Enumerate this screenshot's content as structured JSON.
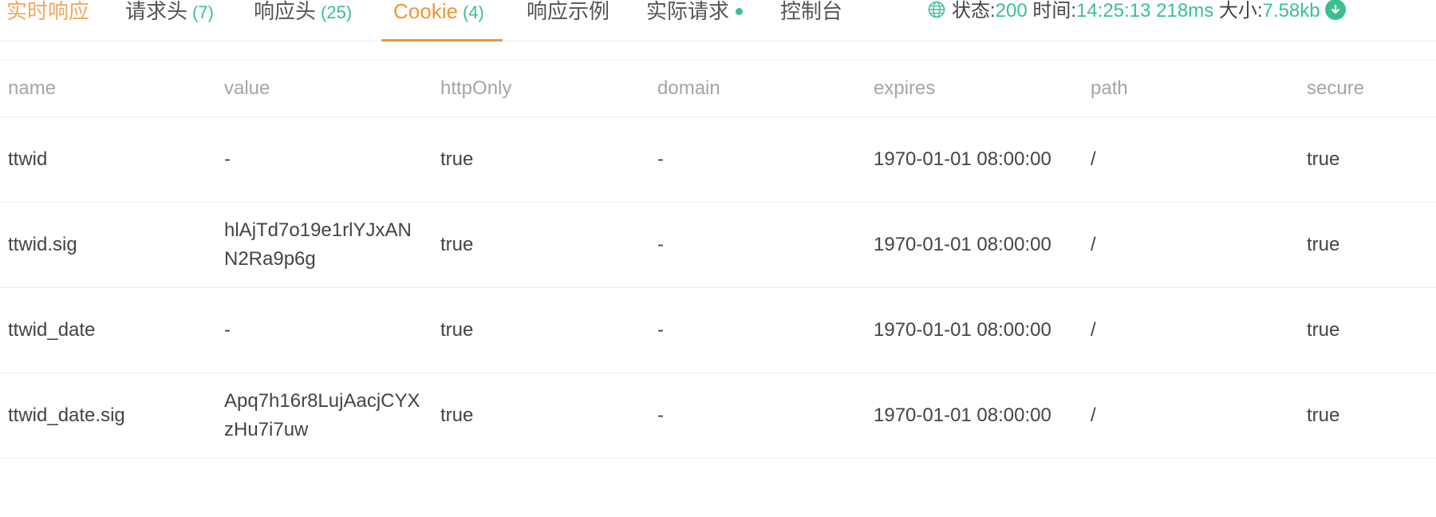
{
  "tabs": [
    {
      "label": "实时响应",
      "count": ""
    },
    {
      "label": "请求头",
      "count": "(7)"
    },
    {
      "label": "响应头",
      "count": "(25)"
    },
    {
      "label": "Cookie",
      "count": "(4)"
    },
    {
      "label": "响应示例",
      "count": ""
    },
    {
      "label": "实际请求",
      "count": ""
    },
    {
      "label": "控制台",
      "count": ""
    }
  ],
  "active_tab": "Cookie",
  "status_bar": {
    "status_label": "状态:",
    "status_value": "200",
    "time_label": "时间:",
    "time_value": "14:25:13",
    "duration_value": "218ms",
    "size_label": "大小:",
    "size_value": "7.58kb"
  },
  "colors": {
    "accent": "#f0953a",
    "success": "#3cbf8f",
    "header_text": "#a5a5a5"
  },
  "icons": {
    "status": "globe-icon",
    "download": "download-icon",
    "realtime_indicator": "green-dot"
  },
  "table": {
    "columns": [
      "name",
      "value",
      "httpOnly",
      "domain",
      "expires",
      "path",
      "secure"
    ],
    "rows": [
      {
        "name": "ttwid",
        "value": "-",
        "httpOnly": "true",
        "domain": "-",
        "expires": "1970-01-01 08:00:00",
        "path": "/",
        "secure": "true"
      },
      {
        "name": "ttwid.sig",
        "value": "hlAjTd7o19e1rlYJxANN2Ra9p6g",
        "httpOnly": "true",
        "domain": "-",
        "expires": "1970-01-01 08:00:00",
        "path": "/",
        "secure": "true"
      },
      {
        "name": "ttwid_date",
        "value": "-",
        "httpOnly": "true",
        "domain": "-",
        "expires": "1970-01-01 08:00:00",
        "path": "/",
        "secure": "true"
      },
      {
        "name": "ttwid_date.sig",
        "value": "Apq7h16r8LujAacjCYXzHu7i7uw",
        "httpOnly": "true",
        "domain": "-",
        "expires": "1970-01-01 08:00:00",
        "path": "/",
        "secure": "true"
      }
    ]
  }
}
